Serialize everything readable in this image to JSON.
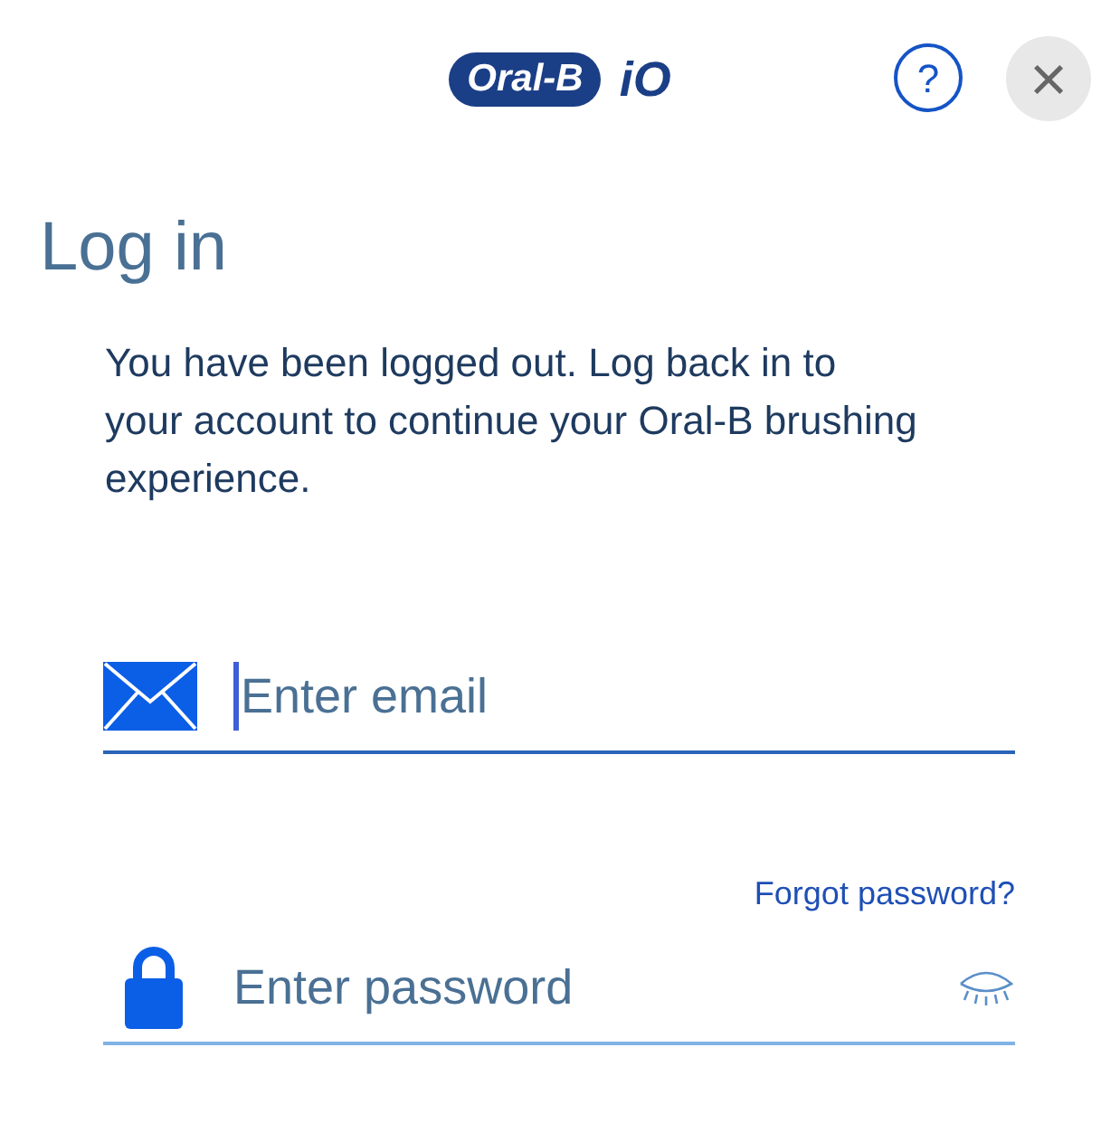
{
  "header": {
    "logo": {
      "brand": "Oral-B",
      "suffix": "iO"
    },
    "help_label": "?",
    "close_label": "×"
  },
  "title": "Log in",
  "message": "You have been logged out. Log back in to your account to continue your Oral-B brushing experience.",
  "fields": [
    {
      "kind": "email",
      "placeholder": "Enter email",
      "focused": true
    },
    {
      "kind": "password",
      "placeholder": "Enter password",
      "focused": false
    }
  ],
  "forgot_link": "Forgot password?"
}
